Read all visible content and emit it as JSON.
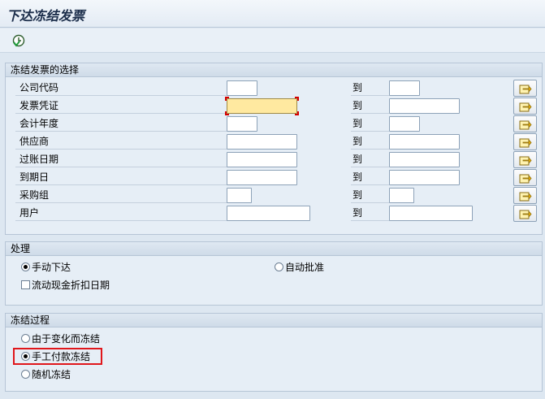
{
  "window": {
    "title": "下达冻结发票"
  },
  "toolbar": {
    "execute_icon": "execute-clock-icon"
  },
  "selection": {
    "header": "冻结发票的选择",
    "to_label": "到",
    "rows": [
      {
        "label": "公司代码",
        "from_value": "",
        "to_value": ""
      },
      {
        "label": "发票凭证",
        "from_value": "",
        "to_value": ""
      },
      {
        "label": "会计年度",
        "from_value": "",
        "to_value": ""
      },
      {
        "label": "供应商",
        "from_value": "",
        "to_value": ""
      },
      {
        "label": "过账日期",
        "from_value": "",
        "to_value": ""
      },
      {
        "label": "到期日",
        "from_value": "",
        "to_value": ""
      },
      {
        "label": "采购组",
        "from_value": "",
        "to_value": ""
      },
      {
        "label": "用户",
        "from_value": "",
        "to_value": ""
      }
    ],
    "multi_select_icon": "multiple-selection-arrow-icon"
  },
  "processing": {
    "header": "处理",
    "option_manual": "手动下达",
    "option_auto": "自动批准",
    "selected": "手动下达",
    "checkbox_label": "流动现金折扣日期",
    "checkbox_checked": false
  },
  "block_procedure": {
    "header": "冻结过程",
    "options": [
      "由于变化而冻结",
      "手工付款冻结",
      "随机冻结"
    ],
    "selected": "手工付款冻结"
  },
  "colors": {
    "highlight": "#e0161b",
    "required_field": "#ffe9a0"
  }
}
